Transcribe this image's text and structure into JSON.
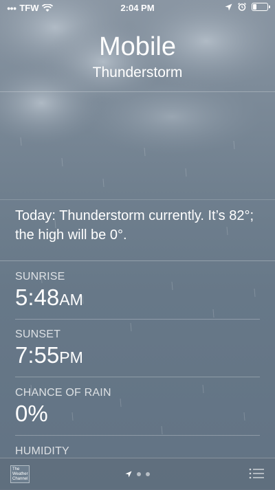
{
  "status_bar": {
    "carrier": "TFW",
    "time": "2:04 PM",
    "battery_level": 0.25
  },
  "location": {
    "city": "Mobile",
    "condition": "Thunderstorm"
  },
  "summary": "Today: Thunderstorm currently. It’s 82°; the high will be 0°.",
  "details": [
    {
      "label": "SUNRISE",
      "value": "5:48",
      "suffix": "AM"
    },
    {
      "label": "SUNSET",
      "value": "7:55",
      "suffix": "PM"
    },
    {
      "label": "CHANCE OF RAIN",
      "value": "0%"
    },
    {
      "label": "HUMIDITY"
    }
  ],
  "bottom_bar": {
    "logo_text": "The Weather Channel"
  },
  "icons": [
    "wifi-icon",
    "location-arrow-icon",
    "alarm-icon",
    "battery-icon",
    "page-location-icon",
    "list-icon"
  ]
}
